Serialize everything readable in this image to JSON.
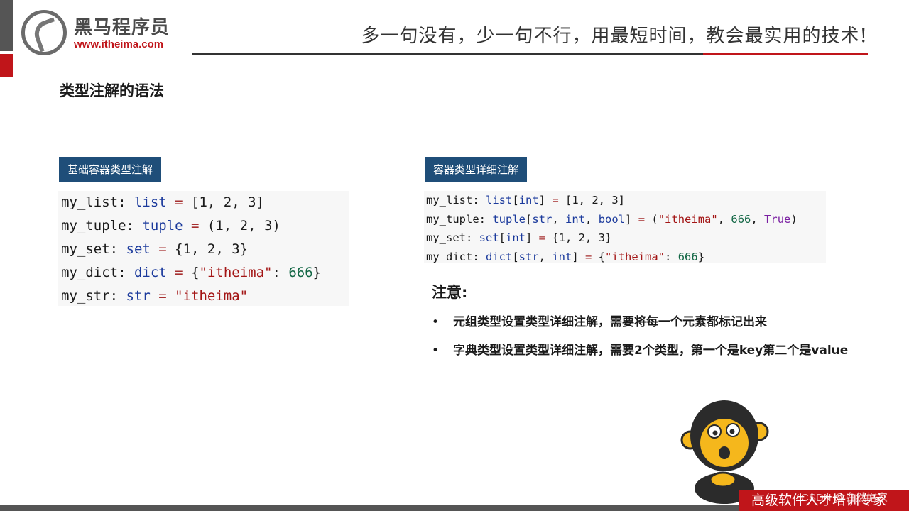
{
  "header": {
    "logo_cn": "黑马程序员",
    "logo_url": "www.itheima.com",
    "slogan": "多一句没有，少一句不行，用最短时间，教会最实用的技术!"
  },
  "slide": {
    "title": "类型注解的语法",
    "left_label": "基础容器类型注解",
    "right_label": "容器类型详细注解"
  },
  "code_left": [
    [
      [
        "my_list: ",
        ""
      ],
      [
        "list",
        "kw"
      ],
      [
        " = ",
        "op"
      ],
      [
        "[1, 2, 3]",
        ""
      ]
    ],
    [
      [
        "my_tuple: ",
        ""
      ],
      [
        "tuple",
        "kw"
      ],
      [
        " = ",
        "op"
      ],
      [
        "(1, 2, 3)",
        ""
      ]
    ],
    [
      [
        "my_set: ",
        ""
      ],
      [
        "set",
        "kw"
      ],
      [
        " = ",
        "op"
      ],
      [
        "{1, 2, 3}",
        ""
      ]
    ],
    [
      [
        "my_dict: ",
        ""
      ],
      [
        "dict",
        "kw"
      ],
      [
        " = ",
        "op"
      ],
      [
        "{",
        ""
      ],
      [
        "\"itheima\"",
        "str"
      ],
      [
        ": ",
        ""
      ],
      [
        "666",
        "num"
      ],
      [
        "}",
        ""
      ]
    ],
    [
      [
        "my_str: ",
        ""
      ],
      [
        "str",
        "kw"
      ],
      [
        " = ",
        "op"
      ],
      [
        "\"itheima\"",
        "str"
      ]
    ]
  ],
  "code_right": [
    [
      [
        "my_list: ",
        ""
      ],
      [
        "list",
        "kw"
      ],
      [
        "[",
        ""
      ],
      [
        "int",
        "kw"
      ],
      [
        "]",
        ""
      ],
      [
        " = ",
        "op"
      ],
      [
        "[1, 2, 3]",
        ""
      ]
    ],
    [
      [
        "my_tuple: ",
        ""
      ],
      [
        "tuple",
        "kw"
      ],
      [
        "[",
        ""
      ],
      [
        "str",
        "kw"
      ],
      [
        ", ",
        ""
      ],
      [
        "int",
        "kw"
      ],
      [
        ", ",
        ""
      ],
      [
        "bool",
        "kw"
      ],
      [
        "]",
        ""
      ],
      [
        " = ",
        "op"
      ],
      [
        "(",
        ""
      ],
      [
        "\"itheima\"",
        "str"
      ],
      [
        ", ",
        ""
      ],
      [
        "666",
        "num"
      ],
      [
        ", ",
        ""
      ],
      [
        "True",
        "bool"
      ],
      [
        ")",
        ""
      ]
    ],
    [
      [
        "my_set: ",
        ""
      ],
      [
        "set",
        "kw"
      ],
      [
        "[",
        ""
      ],
      [
        "int",
        "kw"
      ],
      [
        "]",
        ""
      ],
      [
        " = ",
        "op"
      ],
      [
        "{1, 2, 3}",
        ""
      ]
    ],
    [
      [
        "my_dict: ",
        ""
      ],
      [
        "dict",
        "kw"
      ],
      [
        "[",
        ""
      ],
      [
        "str",
        "kw"
      ],
      [
        ", ",
        ""
      ],
      [
        "int",
        "kw"
      ],
      [
        "]",
        ""
      ],
      [
        " = ",
        "op"
      ],
      [
        "{",
        ""
      ],
      [
        "\"itheima\"",
        "str"
      ],
      [
        ": ",
        ""
      ],
      [
        "666",
        "num"
      ],
      [
        "}",
        ""
      ]
    ]
  ],
  "note": {
    "title": "注意:",
    "bullet": "•",
    "items": [
      "元组类型设置类型详细注解，需要将每一个元素都标记出来",
      "字典类型设置类型详细注解，需要2个类型，第一个是key第二个是value"
    ]
  },
  "footer": {
    "banner": "高级软件人才培训专家",
    "watermark": "CSDN @白然帽家"
  },
  "colors": {
    "brand_red": "#c0151a",
    "label_blue": "#1f4e79",
    "code_bg": "#f7f7f7",
    "mascot_yellow": "#f5b71c"
  }
}
